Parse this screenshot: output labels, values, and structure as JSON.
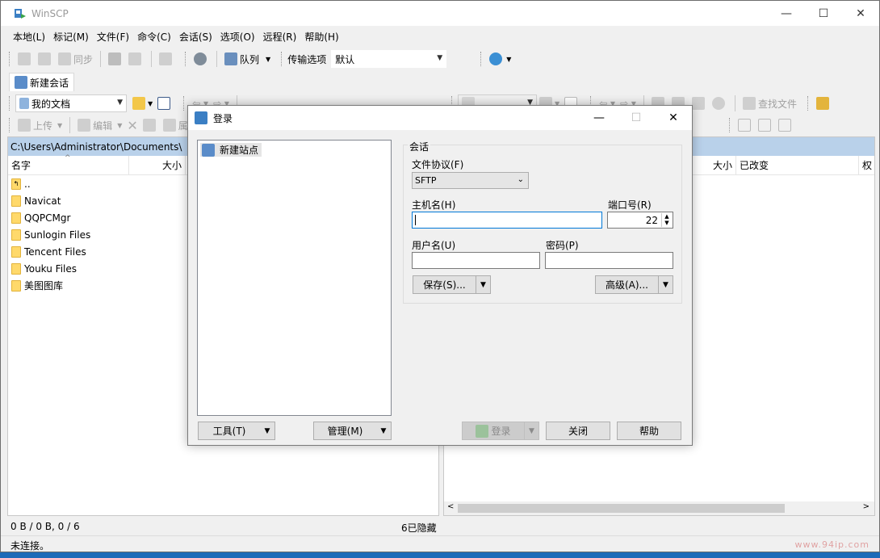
{
  "window": {
    "title": "WinSCP",
    "minimize": "—",
    "maximize": "☐",
    "close": "✕"
  },
  "menu": [
    "本地(L)",
    "标记(M)",
    "文件(F)",
    "命令(C)",
    "会话(S)",
    "选项(O)",
    "远程(R)",
    "帮助(H)"
  ],
  "toolbar1": {
    "sync_label": "同步",
    "queue_label": "队列",
    "transfer_options_label": "传输选项",
    "transfer_default": "默认"
  },
  "session_tab": {
    "label": "新建会话"
  },
  "local": {
    "location": "我的文档",
    "upload_label": "上传",
    "edit_label": "编辑",
    "attr_label": "属",
    "path": "C:\\Users\\Administrator\\Documents\\",
    "columns": [
      "名字",
      "大小"
    ],
    "files": [
      "..",
      "Navicat",
      "QQPCMgr",
      "Sunlogin Files",
      "Tencent Files",
      "Youku Files",
      "美图图库"
    ]
  },
  "remote": {
    "find_files_label": "查找文件",
    "columns": [
      "大小",
      "已改变",
      "权"
    ]
  },
  "status": {
    "selection": "0 B / 0 B,   0 / 6",
    "hidden": "6已隐藏",
    "connection": "未连接。"
  },
  "login_dialog": {
    "title": "登录",
    "site_tree_item": "新建站点",
    "group_title": "会话",
    "protocol_label": "文件协议(F)",
    "protocol_value": "SFTP",
    "host_label": "主机名(H)",
    "host_value": "",
    "port_label": "端口号(R)",
    "port_value": "22",
    "user_label": "用户名(U)",
    "user_value": "",
    "password_label": "密码(P)",
    "password_value": "",
    "save_button": "保存(S)...",
    "advanced_button": "高级(A)...",
    "tools_button": "工具(T)",
    "manage_button": "管理(M)",
    "login_button": "登录",
    "close_button": "关闭",
    "help_button": "帮助"
  },
  "watermark": "www.94ip.com",
  "colors": {
    "path_bar": "#b9d1ea",
    "focus_border": "#0078d7",
    "folder": "#ffd96b",
    "desktop": "#1e6bb8"
  }
}
